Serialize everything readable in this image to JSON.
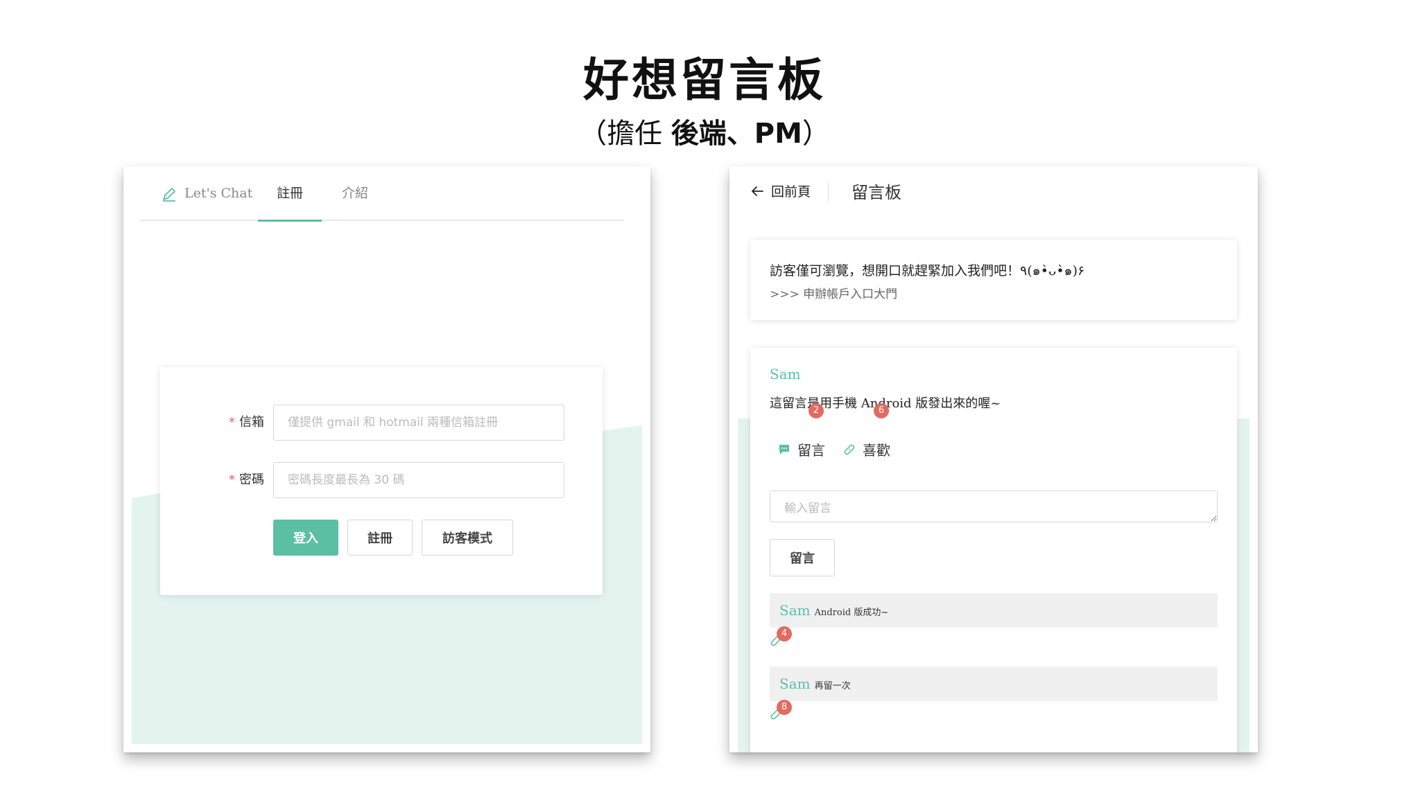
{
  "slide": {
    "title": "好想留言板",
    "subtitle_prefix": "（擔任 ",
    "subtitle_bold": "後端、PM",
    "subtitle_suffix": "）"
  },
  "left": {
    "nav": {
      "logo_icon": "pencil-icon",
      "logo_label": "Let's Chat",
      "tabs": [
        {
          "label": "註冊",
          "active": true
        },
        {
          "label": "介紹",
          "active": false
        }
      ]
    },
    "form": {
      "email_label": "信箱",
      "email_placeholder": "僅提供 gmail 和 hotmail 兩種信箱註冊",
      "password_label": "密碼",
      "password_placeholder": "密碼長度最長為 30 碼",
      "required_mark": "*",
      "login_button": "登入",
      "register_button": "註冊",
      "guest_button": "訪客模式"
    },
    "accent_color": "#5bbfa3",
    "wave_color": "#e3f4ef"
  },
  "right": {
    "header": {
      "back_label": "回前頁",
      "title": "留言板"
    },
    "notice": {
      "message": "訪客僅可瀏覽，想開口就趕緊加入我們吧！٩(๑•̀ᴗ•̀๑)۶",
      "link": ">>> 申辦帳戶入口大門"
    },
    "post": {
      "author": "Sam",
      "body": "這留言是用手機 Android 版發出來的喔~",
      "comment_action": {
        "label": "留言",
        "count": "2",
        "icon": "chat-bubble-icon"
      },
      "like_action": {
        "label": "喜歡",
        "count": "6",
        "icon": "bandage-like-icon"
      },
      "comment_placeholder": "輸入留言",
      "comment_button": "留言",
      "comments": [
        {
          "author": "Sam",
          "text": "Android 版成功~",
          "likes": "4"
        },
        {
          "author": "Sam",
          "text": "再留一次",
          "likes": "8"
        }
      ]
    },
    "badge_color": "#e36a60"
  }
}
